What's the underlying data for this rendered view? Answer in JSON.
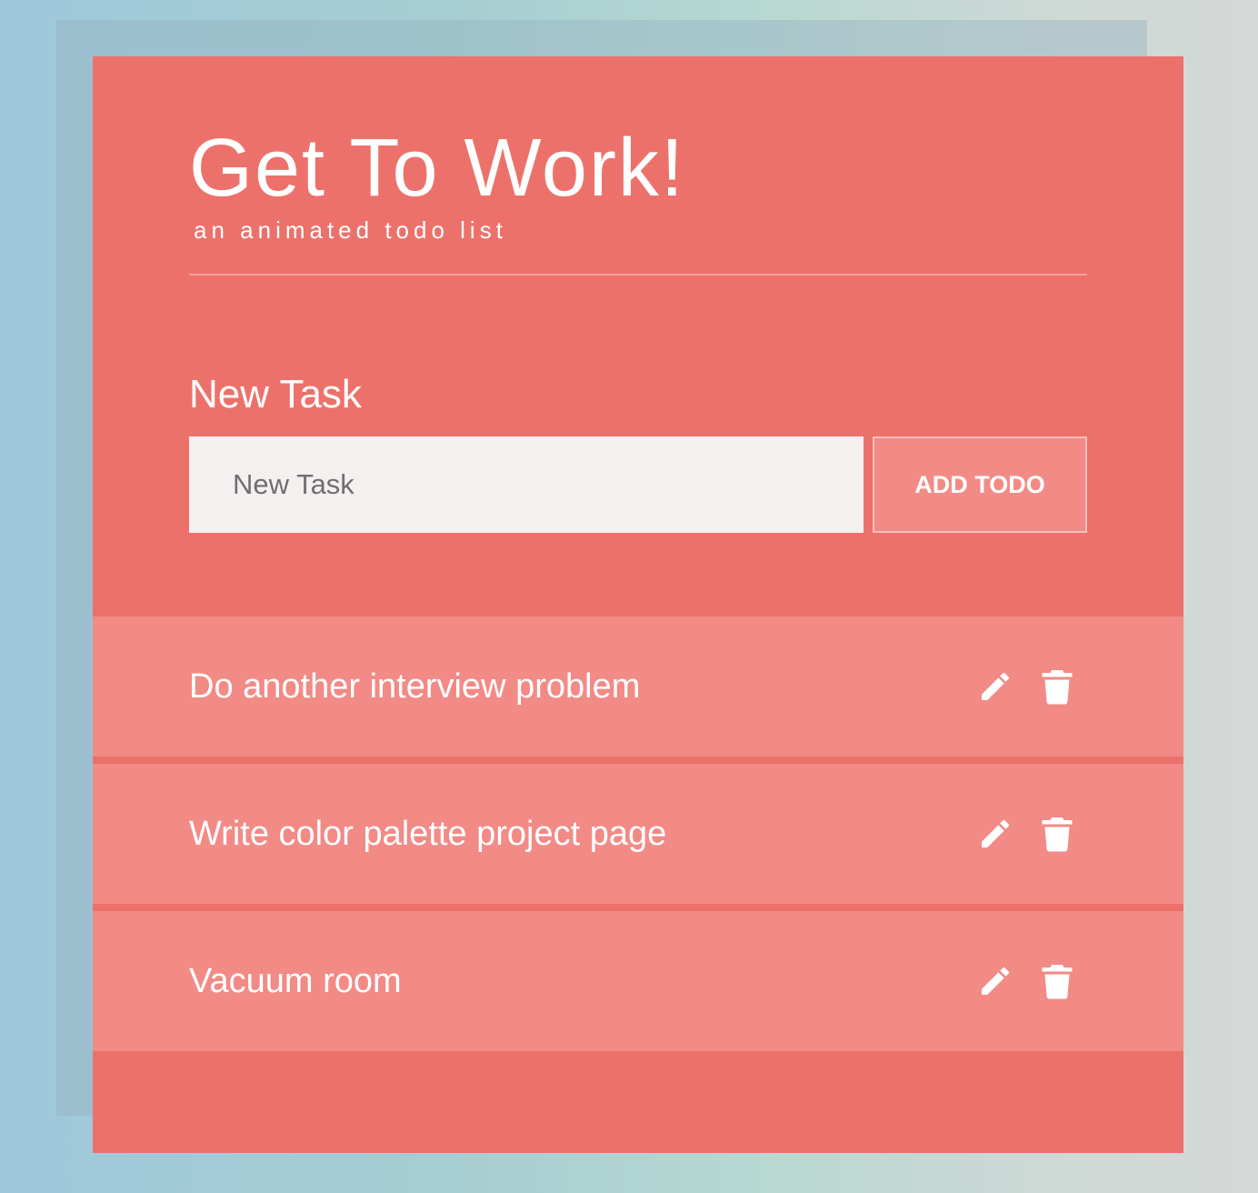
{
  "header": {
    "title": "Get To Work!",
    "subtitle": "an animated todo list"
  },
  "form": {
    "label": "New Task",
    "input_value": "",
    "input_placeholder": "New Task",
    "add_button_label": "ADD TODO"
  },
  "todos": [
    {
      "text": "Do another interview problem",
      "edit_icon": "pencil-icon",
      "delete_icon": "trash-icon"
    },
    {
      "text": "Write color palette project page",
      "edit_icon": "pencil-icon",
      "delete_icon": "trash-icon"
    },
    {
      "text": "Vacuum room",
      "edit_icon": "pencil-icon",
      "delete_icon": "trash-icon"
    }
  ],
  "colors": {
    "card": "#ed716b",
    "todo_row": "#f28a86",
    "input_bg": "#f4f0ef",
    "text": "#ffffff"
  }
}
